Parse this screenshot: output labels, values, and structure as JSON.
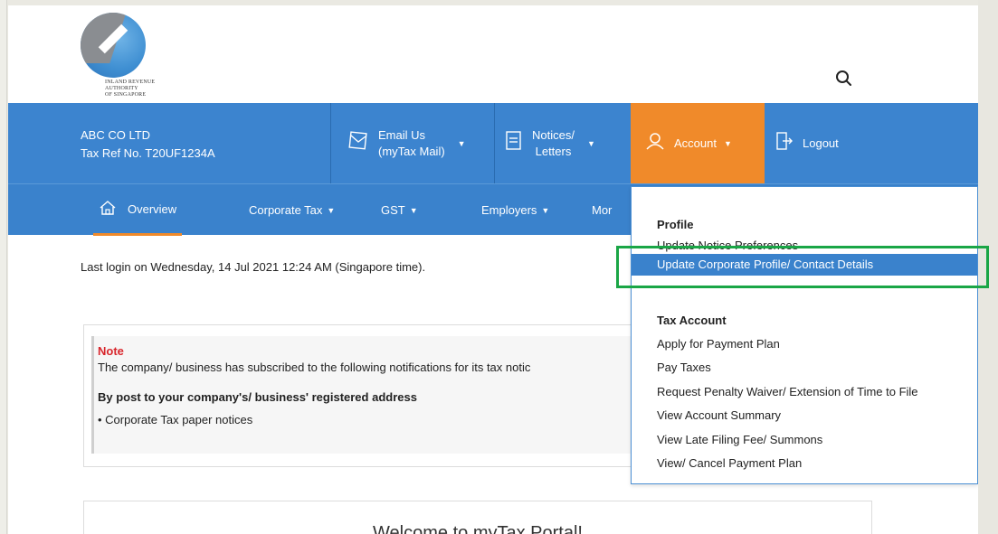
{
  "logo": {
    "lines": [
      "INLAND REVENUE",
      "AUTHORITY",
      "OF SINGAPORE"
    ]
  },
  "header": {
    "search_icon": "search-icon"
  },
  "company": {
    "name": "ABC CO LTD",
    "tax_ref": "Tax Ref No.  T20UF1234A"
  },
  "topnav": {
    "email": {
      "line1": "Email Us",
      "line2": "(myTax Mail)",
      "icon": "mail-icon"
    },
    "notices": {
      "line1": "Notices/",
      "line2": "Letters",
      "icon": "document-icon"
    },
    "account": {
      "label": "Account",
      "icon": "user-icon"
    },
    "logout": {
      "label": "Logout",
      "icon": "logout-icon"
    }
  },
  "subnav": {
    "overview": "Overview",
    "corporate_tax": "Corporate Tax",
    "gst": "GST",
    "employers": "Employers",
    "more": "Mor"
  },
  "main": {
    "last_login": "Last login on Wednesday, 14 Jul 2021 12:24 AM (Singapore time).",
    "note": {
      "title": "Note",
      "body": "The company/ business has subscribed to the following notifications for its tax notic",
      "heading": "By post to your company's/ business' registered address",
      "bullet": "• Corporate Tax paper notices"
    },
    "welcome": "Welcome to myTax Portal!"
  },
  "dropdown": {
    "profile_heading": "Profile",
    "profile_items": [
      "Update Notice Preferences",
      "Update Corporate Profile/ Contact Details"
    ],
    "tax_heading": "Tax Account",
    "tax_items": [
      "Apply for Payment Plan",
      "Pay Taxes",
      "Request Penalty Waiver/ Extension of Time to File",
      "View Account Summary",
      "View Late Filing Fee/ Summons",
      "View/ Cancel Payment Plan"
    ]
  },
  "colors": {
    "nav_blue": "#3c84cf",
    "account_orange": "#f08a2a",
    "highlight_green": "#1aa646",
    "note_red": "#d8262c"
  }
}
